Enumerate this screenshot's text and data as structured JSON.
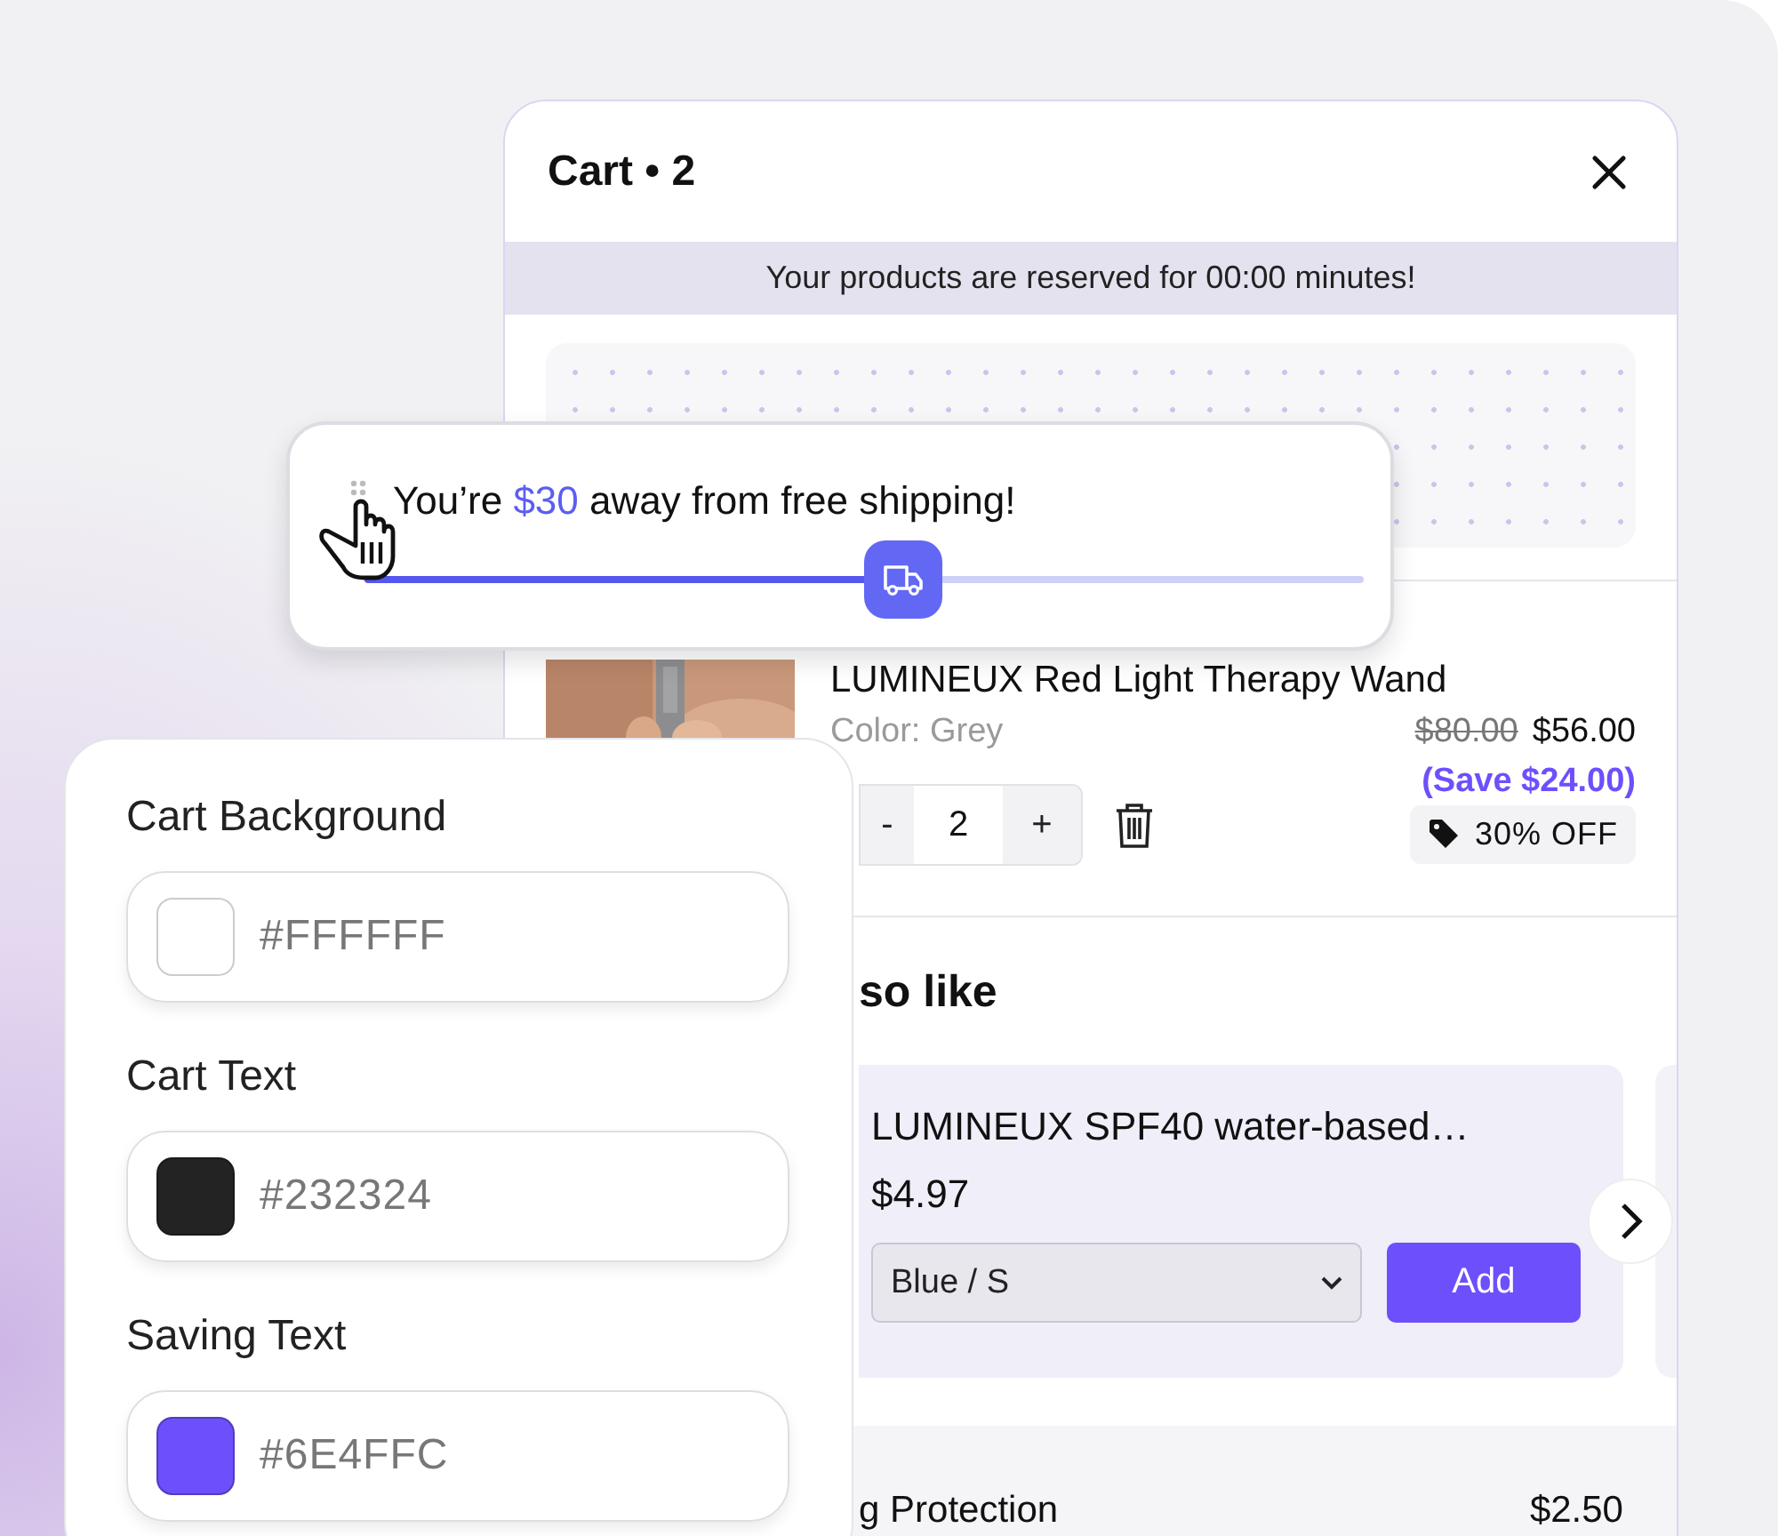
{
  "cart": {
    "title": "Cart • 2",
    "banner": "Your products are reserved for 00:00 minutes!",
    "item": {
      "name": "LUMINEUX Red Light Therapy Wand",
      "variant": "Color: Grey",
      "original_price": "$80.00",
      "price": "$56.00",
      "saving": "(Save $24.00)",
      "discount": "30% OFF",
      "minus": "-",
      "quantity": "2",
      "plus": "+"
    },
    "recommendations": {
      "heading": "so like",
      "products": [
        {
          "name": "LUMINEUX SPF40 water-based…",
          "price": "$4.97",
          "option": "Blue / S",
          "button": "Add"
        }
      ]
    },
    "summary": [
      {
        "label": "g Protection",
        "value": "$2.50"
      }
    ]
  },
  "shipping_bar": {
    "before": "You’re ",
    "amount": "$30",
    "after": " away from free shipping!",
    "level": 0.54
  },
  "color_settings": [
    {
      "label": "Cart Background",
      "value": "#FFFFFF",
      "color": "#ffffff"
    },
    {
      "label": "Cart Text",
      "value": "#232324",
      "color": "#232324"
    },
    {
      "label": "Saving Text",
      "value": "#6E4FFC",
      "color": "#6e4ffc"
    }
  ]
}
